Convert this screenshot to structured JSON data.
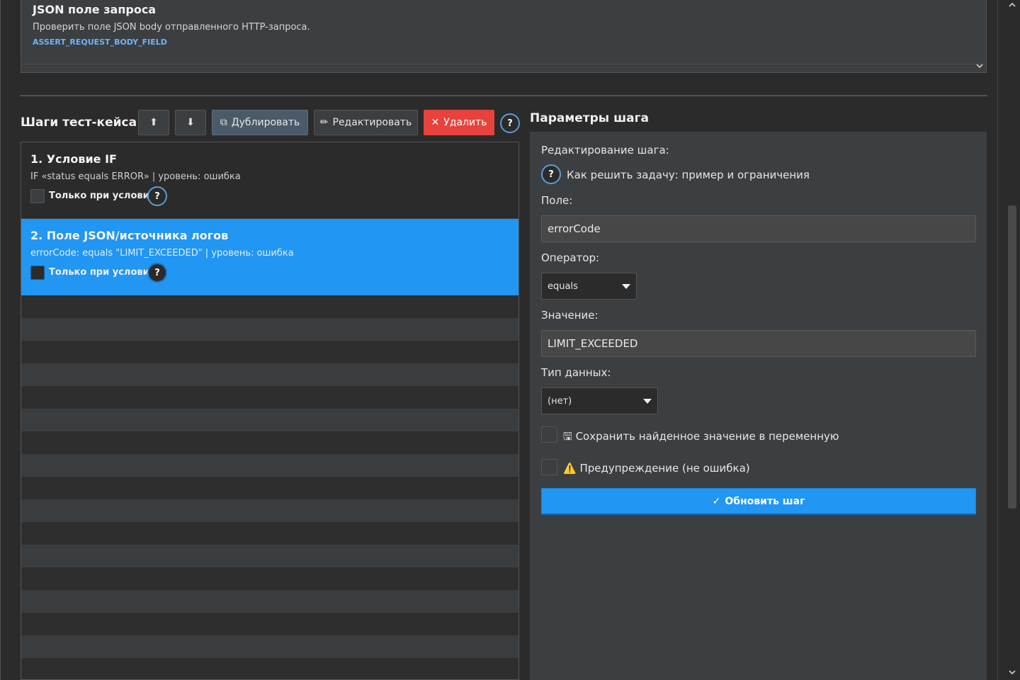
{
  "template_card": {
    "title": "JSON поле запроса",
    "description": "Проверить поле JSON body отправленного HTTP-запроса.",
    "code": "ASSERT_REQUEST_BODY_FIELD",
    "chevron_icon": "chevron-down-icon"
  },
  "toolbar": {
    "heading": "Шаги тест-кейса",
    "move_up_glyph": "⬆",
    "move_down_glyph": "⬇",
    "duplicate_icon": "⧉",
    "duplicate_label": "Дублировать",
    "edit_icon": "✏",
    "edit_label": "Редактировать",
    "delete_icon": "✕",
    "delete_label": "Удалить",
    "help_glyph": "?"
  },
  "steps": [
    {
      "title": "1. Условие IF",
      "meta": "IF «status equals ERROR»  |  уровень: ошибка",
      "condition_label": "Только при условии",
      "help_glyph": "?",
      "selected": false
    },
    {
      "title": "2. Поле JSON/источника логов",
      "meta": "errorCode: equals \"LIMIT_EXCEEDED\"  |  уровень: ошибка",
      "condition_label": "Только при условии",
      "help_glyph": "?",
      "selected": true
    }
  ],
  "params": {
    "heading": "Параметры шага",
    "editing_label": "Редактирование шага:",
    "help_glyph": "?",
    "help_text": "Как решить задачу: пример и ограничения",
    "field_label": "Поле:",
    "field_value": "errorCode",
    "operator_label": "Оператор:",
    "operator_value": "equals",
    "value_label": "Значение:",
    "value_value": "LIMIT_EXCEEDED",
    "datatype_label": "Тип данных:",
    "datatype_value": "(нет)",
    "save_var_icon": "🖫",
    "save_var_label": "Сохранить найденное значение в переменную",
    "warning_icon": "⚠️",
    "warning_label": "Предупреждение (не ошибка)",
    "update_icon": "✓",
    "update_label": "Обновить шаг"
  },
  "colors": {
    "accent": "#2196f3",
    "danger": "#e8423c",
    "background": "#2b2b2b",
    "panel": "#3c3f41"
  }
}
